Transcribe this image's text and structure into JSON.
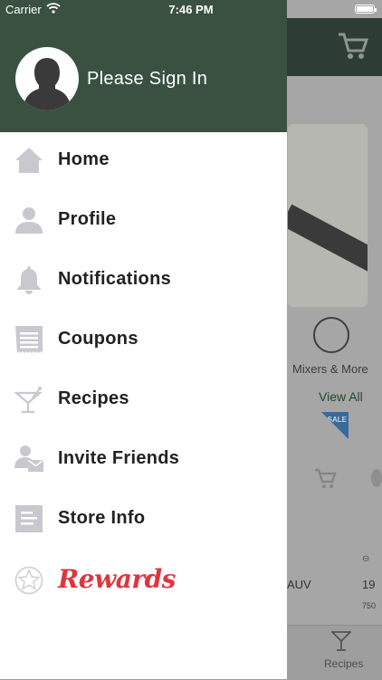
{
  "status_bar": {
    "carrier": "Carrier",
    "time": "7:46 PM"
  },
  "drawer": {
    "sign_in": "Please Sign In",
    "menu_items": [
      {
        "label": "Home",
        "icon": "home-icon"
      },
      {
        "label": "Profile",
        "icon": "person-icon"
      },
      {
        "label": "Notifications",
        "icon": "bell-icon"
      },
      {
        "label": "Coupons",
        "icon": "coupon-icon"
      },
      {
        "label": "Recipes",
        "icon": "cocktail-icon"
      },
      {
        "label": "Invite Friends",
        "icon": "invite-icon"
      },
      {
        "label": "Store Info",
        "icon": "document-icon"
      }
    ],
    "rewards": {
      "label": "Rewards",
      "icon": "star-badge-icon"
    }
  },
  "background": {
    "category_label": "Mixers & More",
    "view_all": "View All",
    "sale_badge": "SALE",
    "product_name_fragment": "AUV",
    "price_fragment": "19",
    "size_fragment": "750",
    "tab_recipes": "Recipes"
  },
  "colors": {
    "drawer_header": "#3a5142",
    "menu_icon_gray": "#c8c8ce",
    "rewards_red": "#e0343f",
    "label_text": "#222222"
  }
}
